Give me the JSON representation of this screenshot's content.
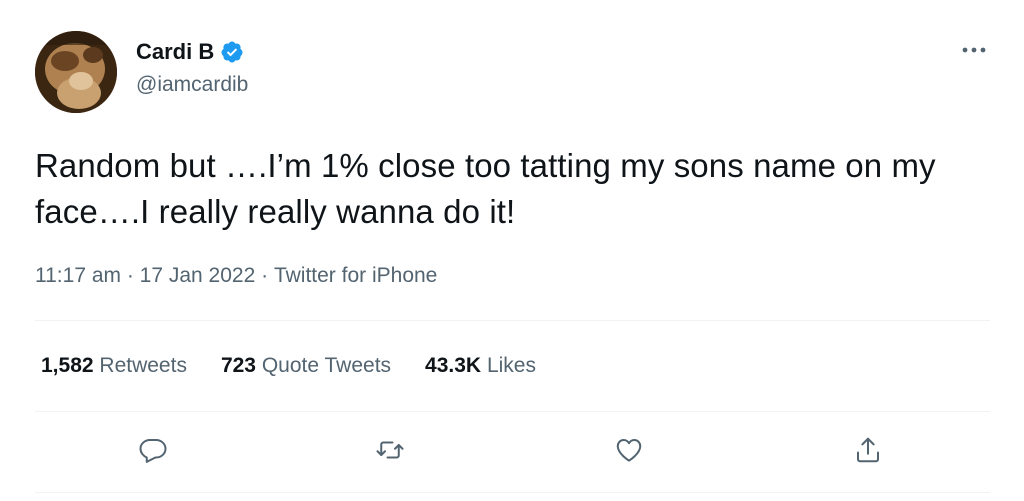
{
  "tweet": {
    "display_name": "Cardi B",
    "handle": "@iamcardib",
    "text": "Random but ….I’m 1% close too tatting my sons name on my face….I really really wanna do it!",
    "time": "11:17 am",
    "separator": " · ",
    "date": "17 Jan 2022",
    "source": "Twitter for iPhone"
  },
  "stats": {
    "retweets": {
      "count": "1,582",
      "label": "Retweets"
    },
    "quotes": {
      "count": "723",
      "label": "Quote Tweets"
    },
    "likes": {
      "count": "43.3K",
      "label": "Likes"
    }
  },
  "icons": {
    "verified": "verified-badge-icon",
    "more": "more-horizontal-icon",
    "reply": "reply-icon",
    "retweet": "retweet-icon",
    "like": "heart-icon",
    "share": "share-icon"
  },
  "colors": {
    "text_primary": "#0f1419",
    "text_secondary": "#536471",
    "verified_blue": "#1d9bf0",
    "divider": "#eff3f4"
  }
}
